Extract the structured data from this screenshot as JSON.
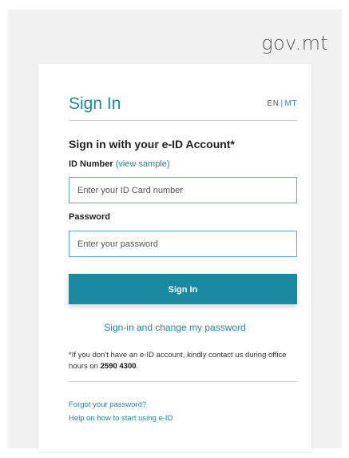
{
  "brand": {
    "logo_gov": "gov",
    "logo_dot": ".",
    "logo_mt": "mt"
  },
  "header": {
    "title": "Sign In",
    "lang_en": "EN",
    "lang_sep": "|",
    "lang_mt": "MT"
  },
  "form": {
    "subtitle": "Sign in with your e-ID Account*",
    "id_label": "ID Number",
    "id_sample_link": "(view sample)",
    "id_placeholder": "Enter your ID Card number",
    "password_label": "Password",
    "password_placeholder": "Enter your password",
    "submit_label": "Sign In",
    "change_password_link": "Sign-in and change my password"
  },
  "note": {
    "text": "*If you don't have an e-ID account, kindly contact us during office hours on ",
    "phone": "2590 4300",
    "end": "."
  },
  "footer": {
    "forgot_password": "Forgot your password?",
    "help": "Help on how to start using e-ID"
  },
  "colors": {
    "accent": "#1a8aa2",
    "logo_dot": "#d01f2f"
  }
}
